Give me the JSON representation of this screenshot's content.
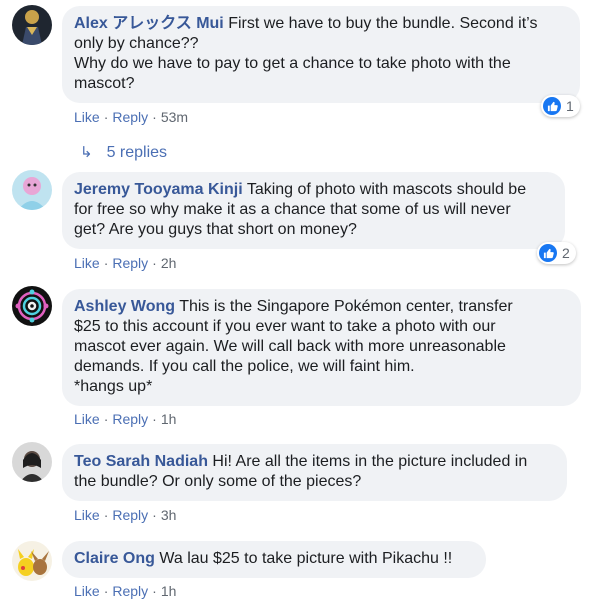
{
  "comments": [
    {
      "author": "Alex アレックス Mui",
      "text": "First we have to buy the bundle. Second it’s\nonly by chance??\nWhy do we have to pay to get a chance to take photo with the\nmascot?",
      "like_label": "Like",
      "reply_label": "Reply",
      "time": "53m",
      "reaction_count": "1",
      "reaction_icon": "thumbs-up-icon",
      "replies_label": "5 replies"
    },
    {
      "author": "Jeremy Tooyama Kinji",
      "text": "Taking of photo with mascots should be\nfor free so why make it as a chance that some of us will never\nget? Are you guys that short on money?",
      "like_label": "Like",
      "reply_label": "Reply",
      "time": "2h",
      "reaction_count": "2",
      "reaction_icon": "thumbs-up-icon"
    },
    {
      "author": "Ashley Wong",
      "text": "This is the Singapore Pokémon center, transfer\n$25 to this account if you ever want to take a photo with our\nmascot ever again. We will call back with more unreasonable\ndemands. If you call the police, we will faint him.\n*hangs up*",
      "like_label": "Like",
      "reply_label": "Reply",
      "time": "1h"
    },
    {
      "author": "Teo Sarah Nadiah",
      "text": "Hi! Are all the items in the picture included in\nthe bundle? Or only some of the pieces?",
      "like_label": "Like",
      "reply_label": "Reply",
      "time": "3h"
    },
    {
      "author": "Claire Ong",
      "text": "Wa lau $25 to take picture with Pikachu !!",
      "like_label": "Like",
      "reply_label": "Reply",
      "time": "1h"
    }
  ],
  "colors": {
    "author": "#385898",
    "bubble": "#f0f2f5",
    "like_badge": "#1877f2",
    "action_link": "#4b6fb4"
  }
}
